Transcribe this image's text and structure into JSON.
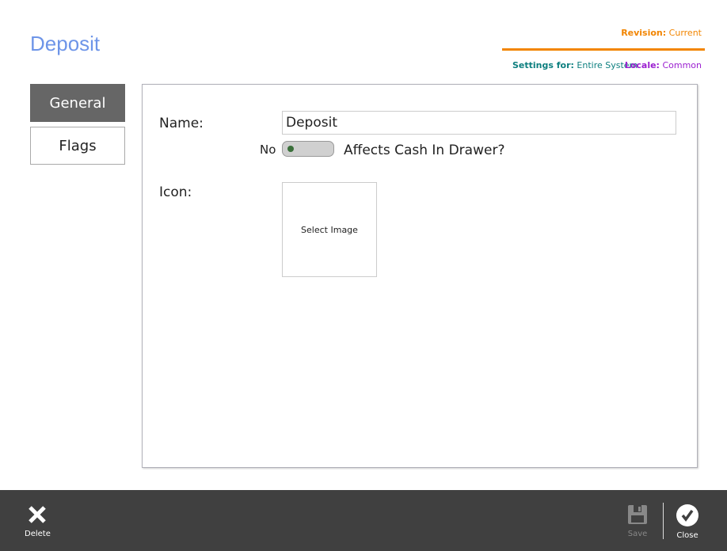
{
  "header": {
    "title": "Deposit",
    "revision_label": "Revision:",
    "revision_value": "Current",
    "settings_label": "Settings for:",
    "settings_value": "Entire System",
    "locale_label": "Locale:",
    "locale_value": "Common"
  },
  "tabs": [
    {
      "label": "General",
      "active": true
    },
    {
      "label": "Flags",
      "active": false
    }
  ],
  "form": {
    "name_label": "Name:",
    "name_value": "Deposit",
    "toggle_state": "No",
    "toggle_on": 0,
    "toggle_label": "Affects Cash In Drawer?",
    "icon_label": "Icon:",
    "select_image": "Select Image"
  },
  "footer": {
    "delete": "Delete",
    "save": "Save",
    "close": "Close"
  }
}
